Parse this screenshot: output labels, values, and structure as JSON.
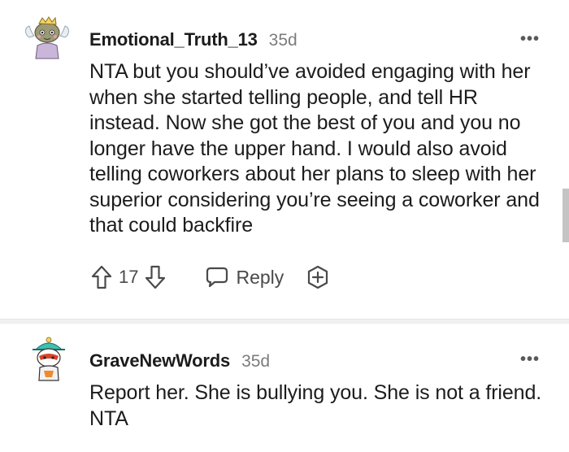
{
  "comments": [
    {
      "username": "Emotional_Truth_13",
      "timestamp": "35d",
      "avatar_icon": "snoo-avatar-icon",
      "more_icon": "more-options-icon",
      "more_label": "•••",
      "body": "NTA but you should’ve avoided engaging with her when she started telling people, and tell HR instead. Now she got the best of you and you no longer have the upper hand. I would also avoid telling coworkers about her plans to sleep with her superior considering you’re seeing a coworker and that could backfire",
      "votes": "17",
      "reply_label": "Reply",
      "upvote_icon": "upvote-arrow-icon",
      "downvote_icon": "downvote-arrow-icon",
      "reply_icon": "speech-bubble-icon",
      "award_icon": "award-plus-icon"
    },
    {
      "username": "GraveNewWords",
      "timestamp": "35d",
      "avatar_icon": "snoo-avatar-icon",
      "more_icon": "more-options-icon",
      "more_label": "•••",
      "body": "Report her. She is bullying you. She is not a friend. NTA"
    }
  ],
  "colors": {
    "text": "#1c1c1c",
    "muted": "#7c7c7c",
    "icon": "#4a4a4a",
    "divider": "#f1f1f1",
    "background": "#ffffff"
  }
}
